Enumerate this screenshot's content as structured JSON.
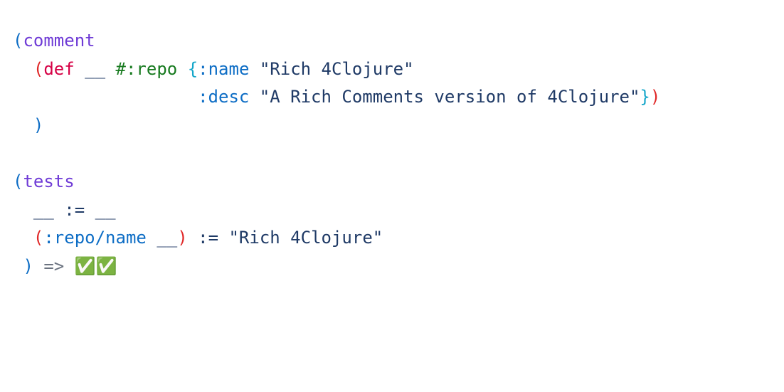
{
  "line1": {
    "lp": "(",
    "comment": "comment"
  },
  "line2": {
    "lp1": "(",
    "def": "def",
    "blank": "__",
    "hash": "#",
    "ns": ":repo",
    "lb": "{",
    "kname": ":name",
    "sname": "\"Rich 4Clojure\""
  },
  "line3": {
    "kdesc": ":desc",
    "sdesc": "\"A Rich Comments version of 4Clojure\"",
    "rb": "}",
    "rp": ")"
  },
  "line4": {
    "rp": ")"
  },
  "line6": {
    "lp": "(",
    "tests": "tests"
  },
  "line7": {
    "b1": "__",
    "op": ":=",
    "b2": "__"
  },
  "line8": {
    "lp": "(",
    "key": ":repo/name",
    "blank": "__",
    "rp": ")",
    "op": ":=",
    "str": "\"Rich 4Clojure\""
  },
  "line9": {
    "rp": ")",
    "arrow": "=>",
    "ok": "✅✅"
  }
}
